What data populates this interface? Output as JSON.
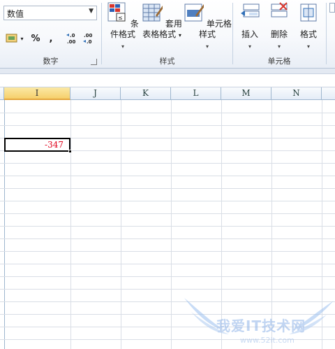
{
  "ribbon": {
    "number_group": {
      "label": "数字",
      "format_value": "数值",
      "percent_label": "%",
      "comma_label": ",",
      "increase_decimal_label": ".0→.00",
      "decrease_decimal_label": ".00→.0"
    },
    "styles_group": {
      "label": "样式",
      "conditional_format_label": "条件格式",
      "table_format_label_line1": "套用",
      "table_format_label_line2": "表格格式",
      "cell_style_label": "单元格样式"
    },
    "cells_group": {
      "label": "单元格",
      "insert_label": "插入",
      "delete_label": "删除",
      "format_label": "格式"
    }
  },
  "sheet": {
    "columns": [
      "I",
      "J",
      "K",
      "L",
      "M",
      "N"
    ],
    "selected_column": "I",
    "active_cell_value": "-347",
    "accent_color": "#e0001b"
  },
  "watermark": {
    "text": "我爱IT技术网",
    "url": "www.52it.com"
  }
}
